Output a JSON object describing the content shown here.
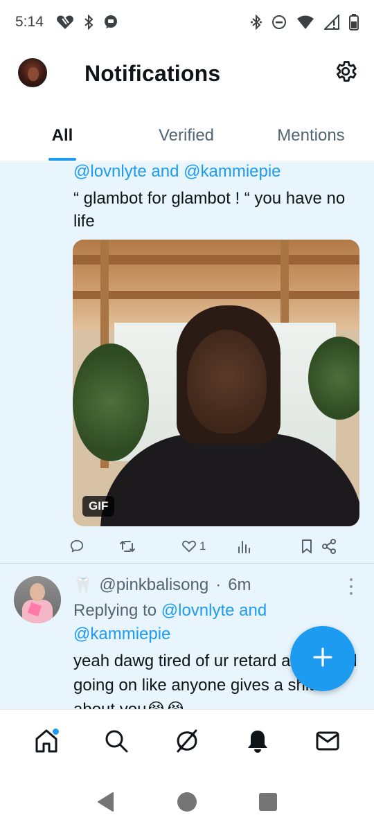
{
  "status_bar": {
    "time": "5:14",
    "left_icons": [
      "heart-broken-icon",
      "bluetooth-icon",
      "messenger-icon"
    ],
    "right_icons": [
      "bluetooth-icon",
      "do-not-disturb-icon",
      "wifi-icon",
      "signal-icon",
      "battery-icon"
    ]
  },
  "header": {
    "title": "Notifications",
    "settings_icon": "gear-icon"
  },
  "tabs": [
    {
      "label": "All",
      "active": true
    },
    {
      "label": "Verified",
      "active": false
    },
    {
      "label": "Mentions",
      "active": false
    }
  ],
  "tweets": [
    {
      "mentions": "@lovnlyte and @kammiepie",
      "text": "“ glambot for glambot ! “ you have no life",
      "media": {
        "type": "gif",
        "badge": "GIF"
      },
      "actions": {
        "reply_count": "",
        "retweet_count": "",
        "like_count": "1",
        "views_count": ""
      }
    },
    {
      "handle": "@pinkbalisong",
      "separator": "·",
      "time": "6m",
      "badge_icon": "tooth-icon",
      "replying_prefix": "Replying to",
      "replying_mention_1": "@lovnlyte",
      "replying_and": "and",
      "replying_mention_2": "@kammiepie",
      "text": "yeah dawg tired of ur retard and ur still going on like anyone gives a shit about you😭😭"
    }
  ],
  "fab": {
    "icon": "plus-icon"
  },
  "bottom_nav": [
    {
      "name": "home",
      "icon": "home-icon",
      "active": true,
      "has_dot": true
    },
    {
      "name": "search",
      "icon": "search-icon"
    },
    {
      "name": "grok",
      "icon": "grok-icon"
    },
    {
      "name": "notifications",
      "icon": "bell-icon"
    },
    {
      "name": "messages",
      "icon": "mail-icon"
    }
  ],
  "system_nav": [
    "back-icon",
    "home-circle-icon",
    "recents-icon"
  ],
  "colors": {
    "accent": "#1d9bf0",
    "feed_bg": "#e8f5fd",
    "text_primary": "#0f1419",
    "text_secondary": "#536471"
  }
}
